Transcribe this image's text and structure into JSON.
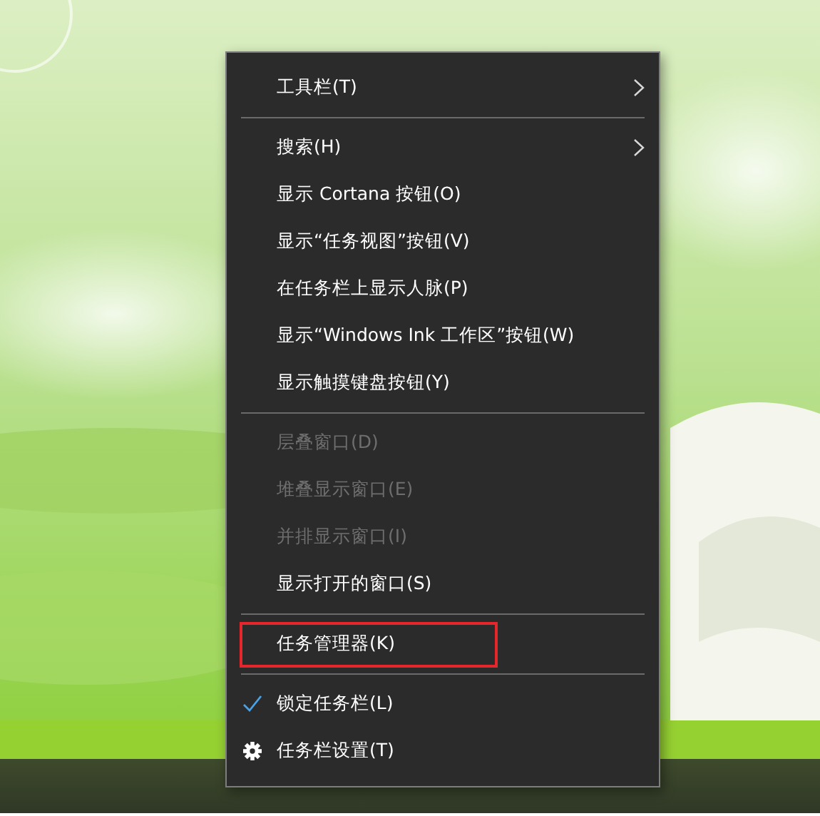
{
  "context_menu": {
    "items": [
      {
        "kind": "item",
        "label": "工具栏(T)",
        "submenu": true
      },
      {
        "kind": "separator"
      },
      {
        "kind": "item",
        "label": "搜索(H)",
        "submenu": true
      },
      {
        "kind": "item",
        "label": "显示 Cortana 按钮(O)"
      },
      {
        "kind": "item",
        "label": "显示“任务视图”按钮(V)"
      },
      {
        "kind": "item",
        "label": "在任务栏上显示人脉(P)"
      },
      {
        "kind": "item",
        "label": "显示“Windows Ink 工作区”按钮(W)"
      },
      {
        "kind": "item",
        "label": "显示触摸键盘按钮(Y)"
      },
      {
        "kind": "separator"
      },
      {
        "kind": "item",
        "label": "层叠窗口(D)",
        "disabled": true
      },
      {
        "kind": "item",
        "label": "堆叠显示窗口(E)",
        "disabled": true
      },
      {
        "kind": "item",
        "label": "并排显示窗口(I)",
        "disabled": true
      },
      {
        "kind": "item",
        "label": "显示打开的窗口(S)"
      },
      {
        "kind": "separator"
      },
      {
        "kind": "item",
        "label": "任务管理器(K)",
        "highlighted": true
      },
      {
        "kind": "separator"
      },
      {
        "kind": "item",
        "label": "锁定任务栏(L)",
        "checked": true
      },
      {
        "kind": "settings",
        "label": "任务栏设置(T)"
      }
    ]
  }
}
